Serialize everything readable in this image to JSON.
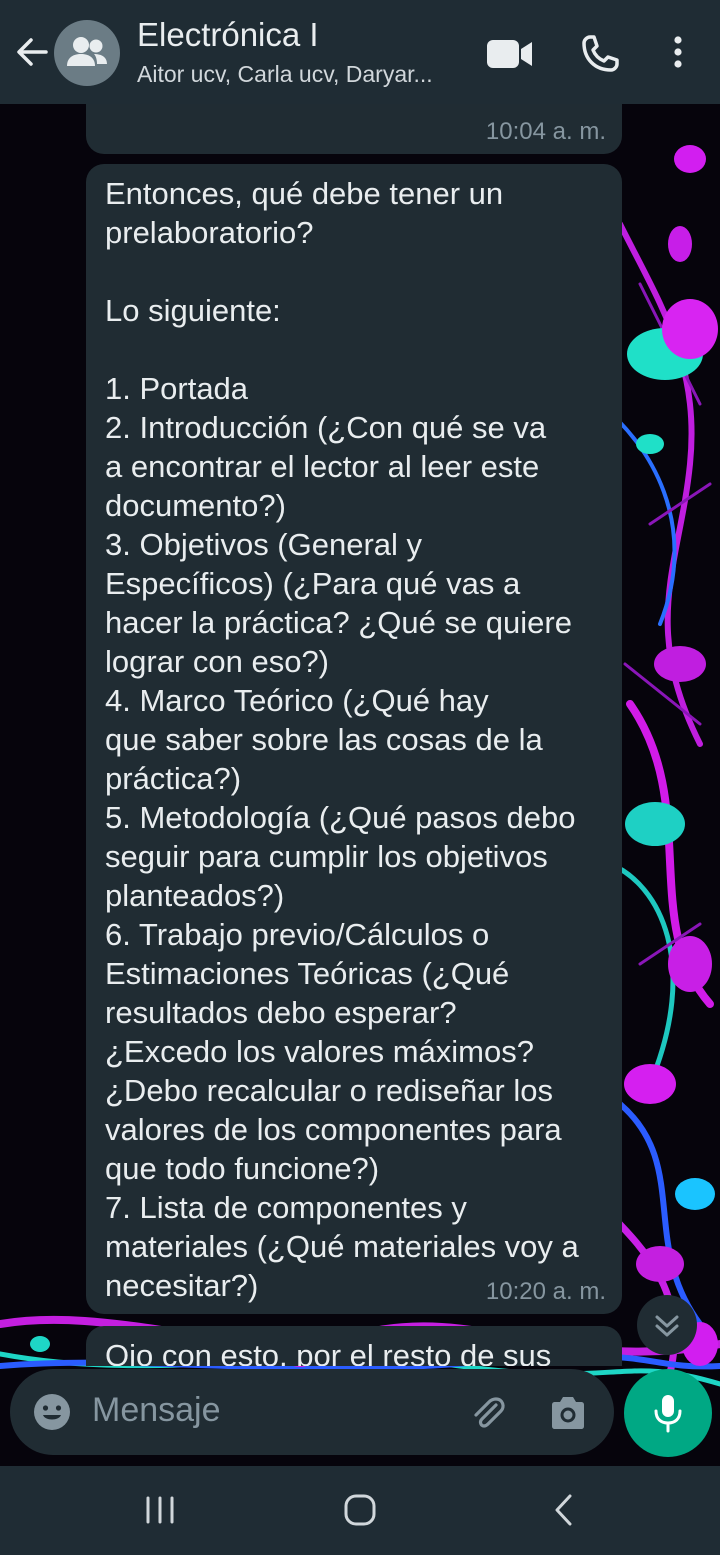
{
  "header": {
    "title": "Electrónica I",
    "subtitle": "Aitor ucv, Carla ucv, Daryar..."
  },
  "messages": {
    "previous": {
      "time": "10:04 a. m."
    },
    "main": {
      "text": "Entonces, qué debe tener un\nprelaboratorio?\n\nLo siguiente:\n\n1. Portada\n2. Introducción (¿Con qué se va\na encontrar el lector al leer este\ndocumento?)\n3. Objetivos (General y\nEspecíficos) (¿Para qué vas a\nhacer la práctica? ¿Qué se quiere\nlograr con eso?)\n4. Marco Teórico (¿Qué hay\nque saber sobre las cosas de la\npráctica?)\n5. Metodología (¿Qué pasos debo\nseguir para cumplir los objetivos\nplanteados?)\n6. Trabajo previo/Cálculos o\nEstimaciones Teóricas (¿Qué\nresultados debo esperar?\n¿Excedo los valores máximos?\n¿Debo recalcular o rediseñar los\nvalores de los componentes para\nque todo funcione?)\n7. Lista de componentes y\nmateriales (¿Qué materiales voy a\nnecesitar?)",
      "time": "10:20 a. m."
    },
    "next": {
      "text": "Ojo con esto, por el resto de sus"
    }
  },
  "composer": {
    "placeholder": "Mensaje"
  },
  "icons": {
    "back": "arrow-left-icon",
    "avatar": "group-icon",
    "video": "video-camera-icon",
    "call": "phone-icon",
    "menu": "more-vertical-icon",
    "emoji": "emoji-icon",
    "attach": "paperclip-icon",
    "camera": "camera-icon",
    "mic": "microphone-icon",
    "scroll": "double-chevron-down-icon"
  },
  "colors": {
    "header_bg": "#1f2c34",
    "bubble_bg": "#202c33",
    "accent": "#00a884",
    "text": "#e9edef",
    "secondary_text": "#8696a0"
  }
}
